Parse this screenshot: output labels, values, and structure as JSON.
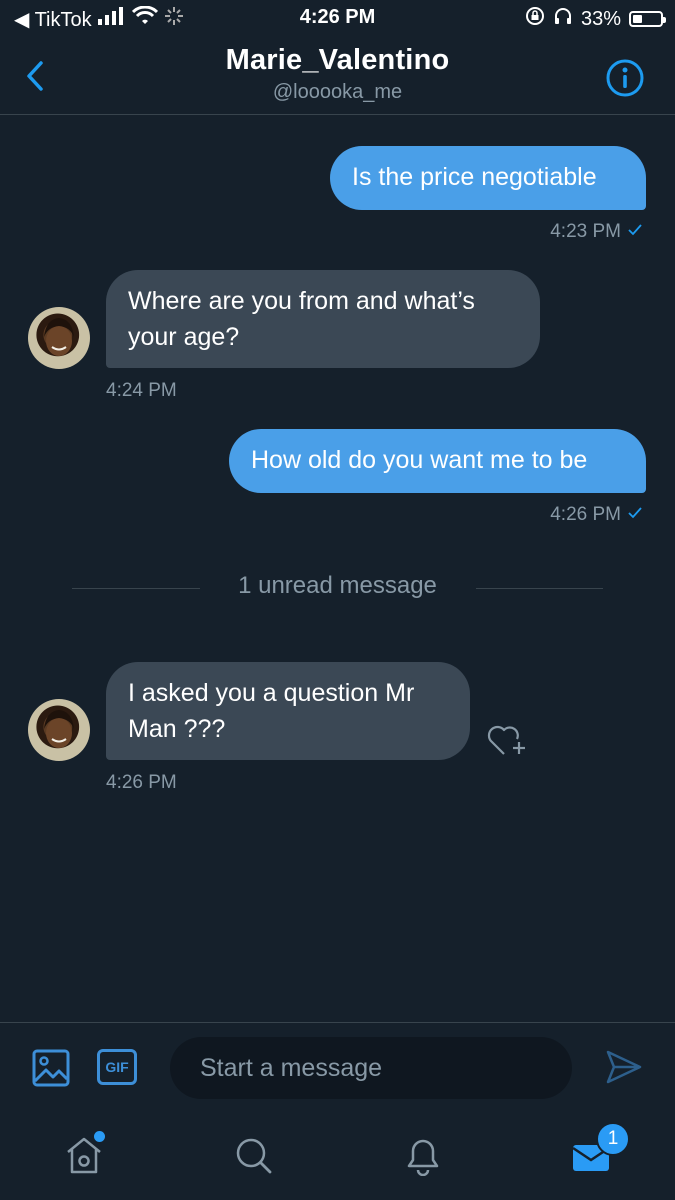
{
  "status_bar": {
    "back_app": "◀ TikTok",
    "time": "4:26 PM",
    "battery": "33%",
    "battery_level": 0.33
  },
  "header": {
    "title": "Marie_Valentino",
    "handle": "@looooka_me"
  },
  "messages": [
    {
      "direction": "out",
      "text": "Is the price negotiable",
      "time": "4:23 PM"
    },
    {
      "direction": "in",
      "text": "Where are you from and what’s your age?",
      "time": "4:24 PM"
    },
    {
      "direction": "out",
      "text": "How old do you want me to be",
      "time": "4:26 PM"
    },
    {
      "direction": "in",
      "text": "I asked you a question Mr Man ???",
      "time": "4:26 PM"
    }
  ],
  "unread_divider": "1 unread message",
  "composer": {
    "gif_label": "GIF",
    "placeholder": "Start a message"
  },
  "tabbar": {
    "messages_badge": "1"
  },
  "colors": {
    "background": "#15202b",
    "accent": "#1d9bf0",
    "incoming_bubble": "#3b4855",
    "muted_text": "#8899a6"
  }
}
